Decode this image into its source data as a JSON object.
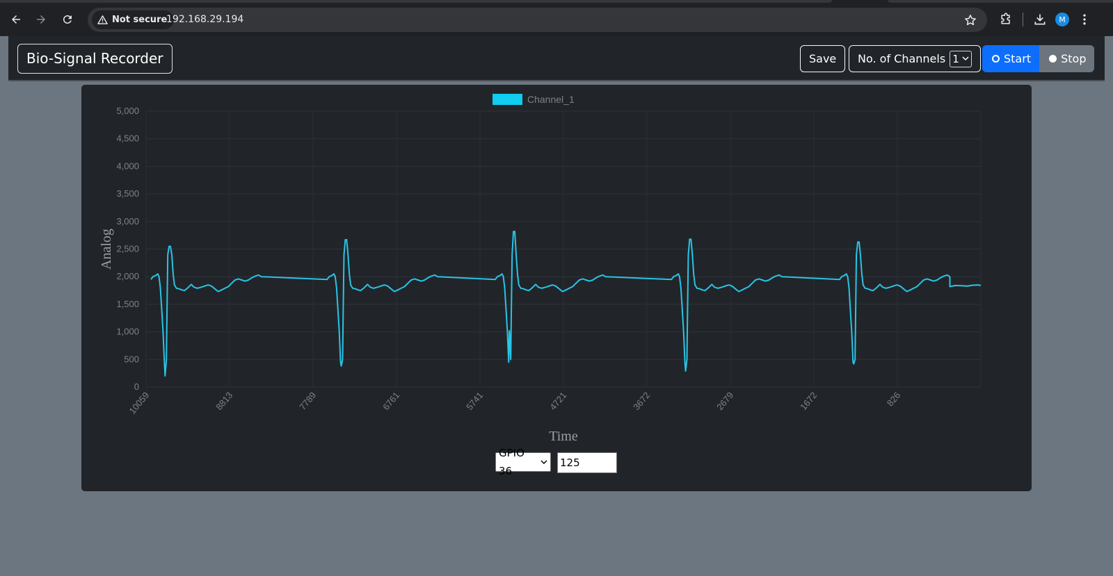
{
  "browser": {
    "security_label": "Not secure",
    "url": "192.168.29.194",
    "avatar_letter": "M"
  },
  "navbar": {
    "brand": "Bio-Signal Recorder",
    "save_label": "Save",
    "channels_label": "No. of Channels",
    "channels_value": "1",
    "start_label": "Start",
    "stop_label": "Stop"
  },
  "controls": {
    "gpio_value": "GPIO 36",
    "input_value": "125"
  },
  "colors": {
    "series": "#29c4e8",
    "legend_box": "#0fccf0",
    "start_button": "#0d6efd",
    "stop_button": "#6c757d"
  },
  "chart_data": {
    "type": "line",
    "xlabel": "Time",
    "ylabel": "Analog",
    "ylim": [
      0,
      5000
    ],
    "yticks": [
      "0",
      "500",
      "1,000",
      "1,500",
      "2,000",
      "2,500",
      "3,000",
      "3,500",
      "4,000",
      "4,500",
      "5,000"
    ],
    "xticks": [
      "10059",
      "8813",
      "7789",
      "6761",
      "5741",
      "4721",
      "3672",
      "2679",
      "1672",
      "826"
    ],
    "legend_position": "top-center",
    "grid": true,
    "series": [
      {
        "name": "Channel_1",
        "beat": [
          [
            0,
            1950
          ],
          [
            3,
            2000
          ],
          [
            7,
            2020
          ],
          [
            10,
            2050
          ],
          [
            12,
            2000
          ],
          [
            14,
            1800
          ],
          [
            16,
            1400
          ],
          [
            18,
            1000
          ],
          [
            20,
            450
          ],
          [
            21,
            200
          ],
          [
            23,
            500
          ],
          [
            24,
            1500
          ],
          [
            25,
            2400
          ],
          [
            27,
            2550
          ],
          [
            29,
            2550
          ],
          [
            31,
            2400
          ],
          [
            33,
            2050
          ],
          [
            35,
            1850
          ],
          [
            38,
            1790
          ],
          [
            42,
            1780
          ],
          [
            46,
            1760
          ],
          [
            50,
            1750
          ],
          [
            55,
            1800
          ],
          [
            60,
            1860
          ],
          [
            64,
            1810
          ],
          [
            69,
            1790
          ],
          [
            75,
            1810
          ],
          [
            80,
            1830
          ],
          [
            85,
            1850
          ],
          [
            90,
            1830
          ],
          [
            95,
            1780
          ],
          [
            100,
            1730
          ],
          [
            105,
            1760
          ],
          [
            110,
            1790
          ],
          [
            115,
            1820
          ],
          [
            120,
            1880
          ],
          [
            125,
            1940
          ],
          [
            130,
            1960
          ],
          [
            135,
            1940
          ],
          [
            140,
            1920
          ],
          [
            145,
            1940
          ],
          [
            150,
            1980
          ],
          [
            155,
            2010
          ],
          [
            160,
            2030
          ],
          [
            164,
            2000
          ]
        ],
        "beat_starts": [
          0,
          262,
          512,
          774,
          1024
        ],
        "beat_r_peak": [
          2550,
          2670,
          2820,
          2680,
          2630
        ],
        "beat_s_trough": [
          200,
          380,
          1020,
          290,
          420
        ],
        "tail": [
          [
            1188,
            1820
          ],
          [
            1196,
            1840
          ],
          [
            1206,
            1835
          ],
          [
            1214,
            1830
          ],
          [
            1222,
            1845
          ],
          [
            1230,
            1850
          ],
          [
            1234,
            1840
          ]
        ]
      }
    ]
  }
}
